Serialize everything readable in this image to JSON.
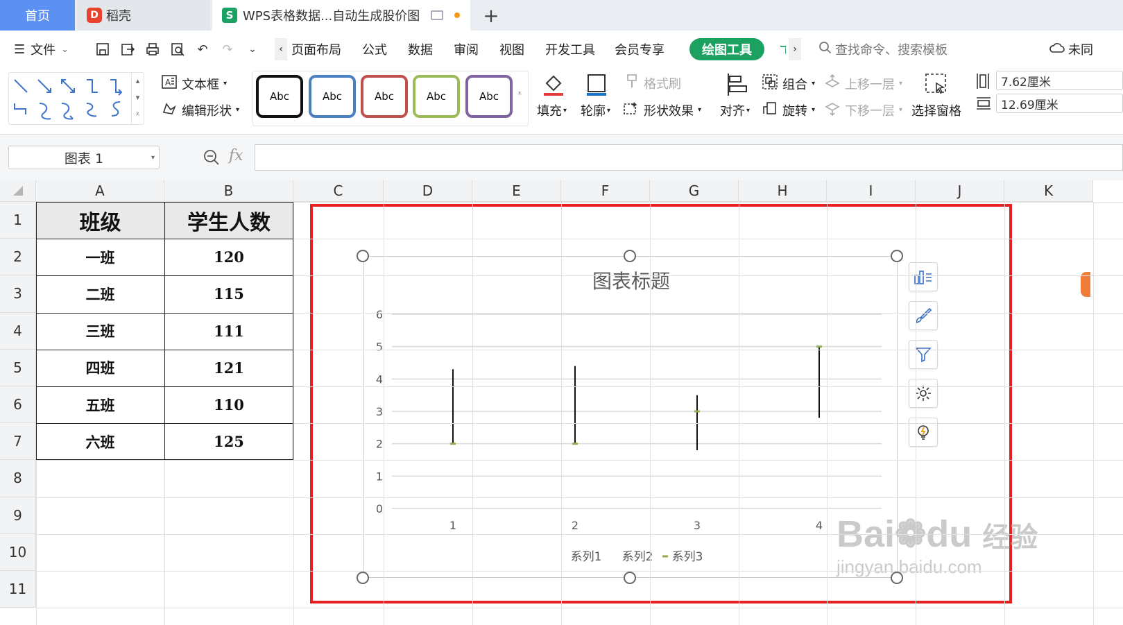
{
  "tabs": {
    "home": "首页",
    "daoke": "稻壳",
    "document": "WPS表格数据...自动生成股价图",
    "daoke_logo": "D",
    "document_logo": "S",
    "add": "+"
  },
  "menu": {
    "file": "文件",
    "items": [
      "页面布局",
      "公式",
      "数据",
      "审阅",
      "视图",
      "开发工具",
      "会员专享"
    ],
    "drawing_tools": "绘图工具",
    "search": "查找命令、搜索模板",
    "cloud": "未同"
  },
  "ribbon": {
    "text_box": "文本框",
    "edit_shape": "编辑形状",
    "style_label": "Abc",
    "style_colors": [
      "#111111",
      "#4a7fc1",
      "#c0504d",
      "#9bbb59",
      "#8064a2"
    ],
    "fill": "填充",
    "outline": "轮廓",
    "format_painter": "格式刷",
    "shape_effect": "形状效果",
    "align": "对齐",
    "group": "组合",
    "rotate": "旋转",
    "bring_forward": "上移一层",
    "send_backward": "下移一层",
    "selection_pane": "选择窗格",
    "height": "7.62厘米",
    "width": "12.69厘米"
  },
  "formula_bar": {
    "name_box": "图表 1",
    "fx": "fx",
    "formula": ""
  },
  "sheet": {
    "columns": [
      "A",
      "B",
      "C",
      "D",
      "E",
      "F",
      "G",
      "H",
      "I",
      "J",
      "K"
    ],
    "rows": [
      "1",
      "2",
      "3",
      "4",
      "5",
      "6",
      "7",
      "8",
      "9",
      "10",
      "11"
    ],
    "header": [
      "班级",
      "学生人数"
    ],
    "data": [
      [
        "一班",
        "120"
      ],
      [
        "二班",
        "115"
      ],
      [
        "三班",
        "111"
      ],
      [
        "四班",
        "121"
      ],
      [
        "五班",
        "110"
      ],
      [
        "六班",
        "125"
      ]
    ]
  },
  "chart_data": {
    "type": "stock",
    "title": "图表标题",
    "categories": [
      "1",
      "2",
      "3",
      "4"
    ],
    "y_ticks": [
      "0",
      "1",
      "2",
      "3",
      "4",
      "5",
      "6"
    ],
    "ylim": [
      0,
      6
    ],
    "grid": true,
    "legend_position": "bottom",
    "series": [
      {
        "name": "系列1",
        "values": [
          4.3,
          4.4,
          3.5,
          5.0
        ]
      },
      {
        "name": "系列2",
        "values": [
          2.0,
          2.0,
          1.8,
          2.8
        ]
      },
      {
        "name": "系列3",
        "values": [
          2.0,
          2.0,
          3.0,
          5.0
        ],
        "color": "#8fb04a"
      }
    ]
  },
  "watermark": {
    "brand": "Bai",
    "brand2": "du",
    "cn": "经验",
    "url": "jingyan.baidu.com"
  }
}
